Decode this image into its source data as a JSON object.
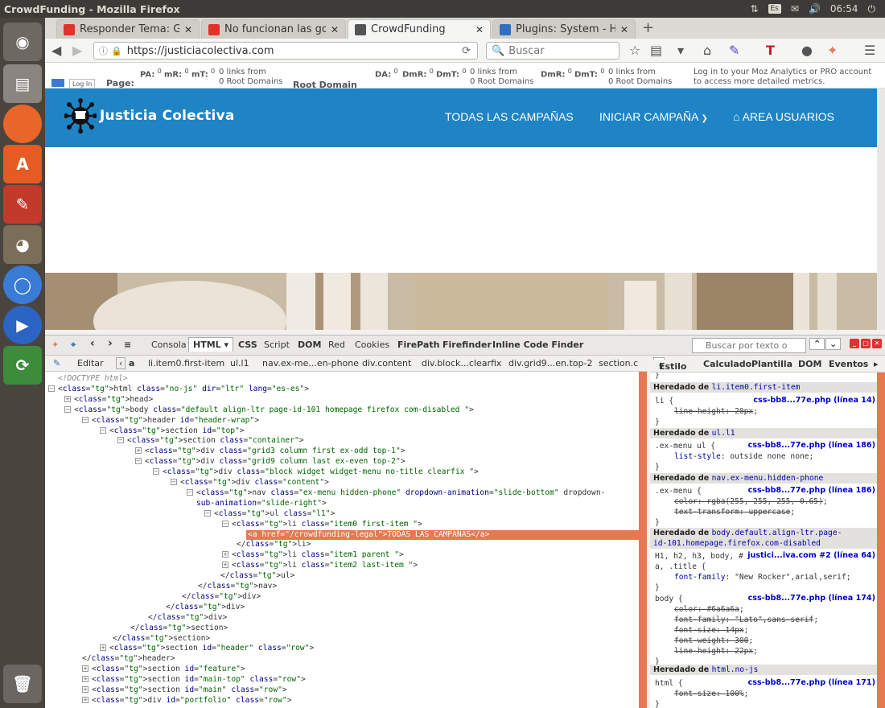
{
  "window": {
    "title": "CrowdFunding - Mozilla Firefox",
    "clock": "06:54",
    "kb_layout": "Es"
  },
  "launcher": [
    "ubuntu-dash-icon",
    "files-icon",
    "firefox-icon",
    "software-center-icon",
    "settings-icon",
    "gimp-icon",
    "chromium-icon",
    "media-player-icon",
    "update-icon",
    "trash-icon"
  ],
  "tabs": [
    {
      "label": "Responder Tema: G...",
      "color": "#e0322b"
    },
    {
      "label": "No funcionan las go...",
      "color": "#e0322b"
    },
    {
      "label": "CrowdFunding",
      "color": "#555555"
    },
    {
      "label": "Plugins: System - H...",
      "color": "#2f6fbf"
    }
  ],
  "nav": {
    "url": "https://justiciacolectiva.com",
    "search_placeholder": "Buscar"
  },
  "mozbar": {
    "pa": "PA:",
    "pa_v": "0",
    "mr": "mR:",
    "mr_v": "0",
    "mt": "mT:",
    "mt_v": "0",
    "links1a": "0 links from",
    "links1b": "0 Root Domains",
    "da": "DA:",
    "da_v": "0",
    "dmr": "DmR:",
    "dmr_v": "0",
    "dmt": "DmT:",
    "dmt_v": "0",
    "links2a": "0 links from",
    "links2b": "0 Root Domains",
    "dmr2": "DmR:",
    "dmr2_v": "0",
    "dmt2": "DmT:",
    "dmt2_v": "0",
    "links3a": "0 links from",
    "links3b": "0 Root Domains",
    "promo1": "Log in to your Moz Analytics or PRO account",
    "promo2": "to access more detailed metrics.",
    "login": "Log In",
    "page": "Page:",
    "root": "Root Domain"
  },
  "site": {
    "logo": "Justicia Colectiva",
    "menu": [
      "TODAS LAS CAMPAÑAS",
      "INICIAR CAMPAÑA",
      "AREA USUARIOS"
    ]
  },
  "firebug": {
    "tabs": [
      "Consola",
      "HTML",
      "CSS",
      "Script",
      "DOM",
      "Red",
      "Cookies",
      "FirePath",
      "Firefinder",
      "Inline Code Finder"
    ],
    "edit": "Editar",
    "search_placeholder": "Buscar por texto o selecto",
    "breadcrumbs": [
      "a",
      "li.item0.first-item",
      "ul.l1",
      "nav.ex-me...en-phone",
      "div.content",
      "div.block...clearfix",
      "div.grid9...en.top-2",
      "section.c"
    ],
    "side_tabs": [
      "Estilo",
      "Calculado",
      "Plantilla",
      "DOM",
      "Eventos"
    ]
  },
  "html_lines": [
    {
      "t": "<!DOCTYPE html>",
      "k": "c"
    },
    {
      "t": "<html class=\"no-js\" dir=\"ltr\" lang=\"es-es\">",
      "p": "-"
    },
    {
      "t": "<head>",
      "p": "+"
    },
    {
      "t": "<body class=\"default align-ltr page-id-101 homepage firefox com-disabled \">",
      "p": "-"
    },
    {
      "t": "<header id=\"header-wrap\">",
      "p": "-"
    },
    {
      "t": "<section id=\"top\">",
      "p": "-"
    },
    {
      "t": "<section class=\"container\">",
      "p": "-"
    },
    {
      "t": "<div class=\"grid3 column first ex-odd top-1\">",
      "p": "+"
    },
    {
      "t": "<div class=\"grid9 column last ex-even top-2\">",
      "p": "-"
    },
    {
      "t": "<div class=\"block widget widget-menu no-title clearfix \">",
      "p": "-"
    },
    {
      "t": "<div class=\"content\">",
      "p": "-"
    },
    {
      "t": "<nav class=\"ex-menu hidden-phone\" dropdown-animation=\"slide-bottom\" dropdown-",
      "p": "-"
    },
    {
      "t": "sub-animation=\"slide-right\">"
    },
    {
      "t": "<ul class=\"l1\">",
      "p": "-"
    },
    {
      "t": "<li class=\"item0 first-item \">",
      "p": "-"
    },
    {
      "t": "<a href=\"/crowdfunding-legal\">TODAS LAS CAMPAÑAS</a>",
      "sel": true
    },
    {
      "t": "</li>"
    },
    {
      "t": "<li class=\"item1 parent \">",
      "p": "+"
    },
    {
      "t": "<li class=\"item2 last-item \">",
      "p": "+"
    },
    {
      "t": "</ul>"
    },
    {
      "t": "</nav>"
    },
    {
      "t": "</div>"
    },
    {
      "t": "</div>"
    },
    {
      "t": "</div>"
    },
    {
      "t": "</section>"
    },
    {
      "t": "</section>"
    },
    {
      "t": "<section id=\"header\" class=\"row\">",
      "p": "+"
    },
    {
      "t": "</header>"
    },
    {
      "t": "<section id=\"feature\">",
      "p": "+"
    },
    {
      "t": "<section id=\"main-top\" class=\"row\">",
      "p": "+"
    },
    {
      "t": "<section id=\"main\" class=\"row\">",
      "p": "+"
    },
    {
      "t": "<div id=\"portfolio\" class=\"row\">",
      "p": "+"
    }
  ],
  "css": {
    "h1": "Heredado de ",
    "h1s": "li.item0.first-item",
    "r1sel": "li {",
    "r1src": "css-bb8...77e.php (línea 14)",
    "r1p": "line-height",
    "r1v": "20px",
    "h2": "Heredado de ",
    "h2s": "ul.l1",
    "r2sel": ".ex-menu ul {",
    "r2src": "css-bb8...77e.php (línea 186)",
    "r2p": "list-style",
    "r2v": "outside none none",
    "h3": "Heredado de ",
    "h3s": "nav.ex-menu.hidden-phone",
    "r3sel": ".ex-menu {",
    "r3src": "css-bb8...77e.php (línea 186)",
    "r3p1": "color",
    "r3v1": "rgba(255, 255, 255, 0.65)",
    "r3p2": "text-transform",
    "r3v2": "uppercase",
    "h4": "Heredado de ",
    "h4s": "body.default.align-ltr.page-",
    "h4s2": "id-101.homepage.firefox.com-disabled",
    "r4sel": "H1, h2, h3, body, #",
    "r4sel2": "a, .title {",
    "r4src": "justici...iva.com #2 (línea 64)",
    "r4p": "font-family",
    "r4v": "\"New Rocker\",arial,serif",
    "r5sel": "body {",
    "r5src": "css-bb8...77e.php (línea 174)",
    "r5p1": "color",
    "r5v1": "#6a6a6a",
    "r5p2": "font-family",
    "r5v2": "\"Lato\",sans-serif",
    "r5p3": "font-size",
    "r5v3": "14px",
    "r5p4": "font-weight",
    "r5v4": "300",
    "r5p5": "line-height",
    "r5v5": "22px",
    "h6": "Heredado de ",
    "h6s": "html.no-js",
    "r6sel": "html {",
    "r6src": "css-bb8...77e.php (línea 171)",
    "r6p": "font-size",
    "r6v": "100%"
  }
}
